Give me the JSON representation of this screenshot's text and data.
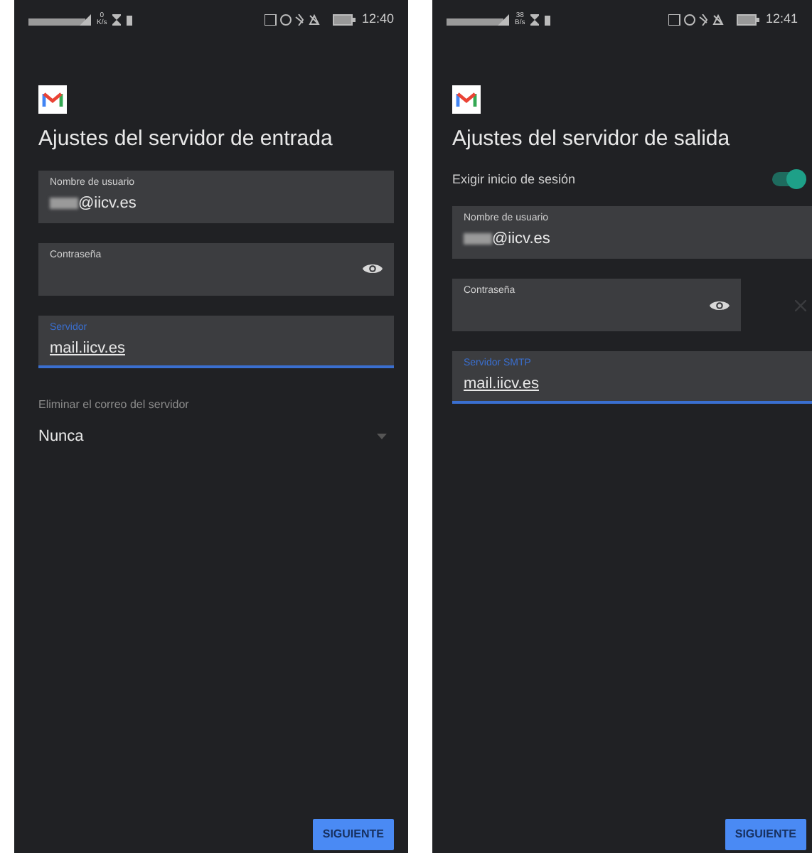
{
  "screens": [
    {
      "status_bar": {
        "speed": "0",
        "speed_unit": "K/s",
        "time": "12:40"
      },
      "title": "Ajustes del servidor de entrada",
      "items": [
        {
          "kind": "text",
          "label": "Nombre de usuario",
          "value": "@iicv.es",
          "redacted": true,
          "focused": false
        },
        {
          "kind": "password",
          "label": "Contraseña",
          "focused": false,
          "clear": false
        },
        {
          "kind": "text",
          "label": "Servidor",
          "value": "mail.iicv.es",
          "redacted": false,
          "focused": true
        },
        {
          "kind": "dropdown",
          "label": "Eliminar el correo del servidor",
          "value": "Nunca"
        }
      ],
      "button": "SIGUIENTE"
    },
    {
      "status_bar": {
        "speed": "38",
        "speed_unit": "B/s",
        "time": "12:41"
      },
      "title": "Ajustes del servidor de salida",
      "items": [
        {
          "kind": "toggle",
          "label": "Exigir inicio de sesión",
          "on": true
        },
        {
          "kind": "text",
          "label": "Nombre de usuario",
          "value": "@iicv.es",
          "redacted": true,
          "focused": false
        },
        {
          "kind": "password",
          "label": "Contraseña",
          "focused": false,
          "clear": true
        },
        {
          "kind": "text",
          "label": "Servidor SMTP",
          "value": "mail.iicv.es",
          "redacted": false,
          "focused": true
        }
      ],
      "button": "SIGUIENTE"
    }
  ]
}
